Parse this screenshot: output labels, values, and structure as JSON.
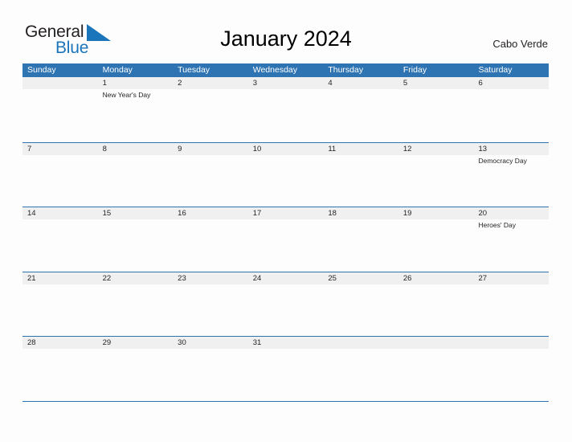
{
  "brand": {
    "name_part1": "General",
    "name_part2": "Blue",
    "triangle_icon": "blue-triangle-icon",
    "primary_color": "#2e73b2",
    "logo_blue": "#1b75bb"
  },
  "header": {
    "title": "January 2024",
    "region": "Cabo Verde"
  },
  "calendar": {
    "weekdays": [
      "Sunday",
      "Monday",
      "Tuesday",
      "Wednesday",
      "Thursday",
      "Friday",
      "Saturday"
    ],
    "header_bg": "#2e73b2",
    "date_band_bg": "#f0f0f0",
    "grid_line_color": "#2e73b2",
    "weeks": [
      {
        "days": [
          {
            "date": "",
            "events": []
          },
          {
            "date": "1",
            "events": [
              "New Year's Day"
            ]
          },
          {
            "date": "2",
            "events": []
          },
          {
            "date": "3",
            "events": []
          },
          {
            "date": "4",
            "events": []
          },
          {
            "date": "5",
            "events": []
          },
          {
            "date": "6",
            "events": []
          }
        ]
      },
      {
        "days": [
          {
            "date": "7",
            "events": []
          },
          {
            "date": "8",
            "events": []
          },
          {
            "date": "9",
            "events": []
          },
          {
            "date": "10",
            "events": []
          },
          {
            "date": "11",
            "events": []
          },
          {
            "date": "12",
            "events": []
          },
          {
            "date": "13",
            "events": [
              "Democracy Day"
            ]
          }
        ]
      },
      {
        "days": [
          {
            "date": "14",
            "events": []
          },
          {
            "date": "15",
            "events": []
          },
          {
            "date": "16",
            "events": []
          },
          {
            "date": "17",
            "events": []
          },
          {
            "date": "18",
            "events": []
          },
          {
            "date": "19",
            "events": []
          },
          {
            "date": "20",
            "events": [
              "Heroes' Day"
            ]
          }
        ]
      },
      {
        "days": [
          {
            "date": "21",
            "events": []
          },
          {
            "date": "22",
            "events": []
          },
          {
            "date": "23",
            "events": []
          },
          {
            "date": "24",
            "events": []
          },
          {
            "date": "25",
            "events": []
          },
          {
            "date": "26",
            "events": []
          },
          {
            "date": "27",
            "events": []
          }
        ]
      },
      {
        "days": [
          {
            "date": "28",
            "events": []
          },
          {
            "date": "29",
            "events": []
          },
          {
            "date": "30",
            "events": []
          },
          {
            "date": "31",
            "events": []
          },
          {
            "date": "",
            "events": []
          },
          {
            "date": "",
            "events": []
          },
          {
            "date": "",
            "events": []
          }
        ]
      }
    ]
  }
}
